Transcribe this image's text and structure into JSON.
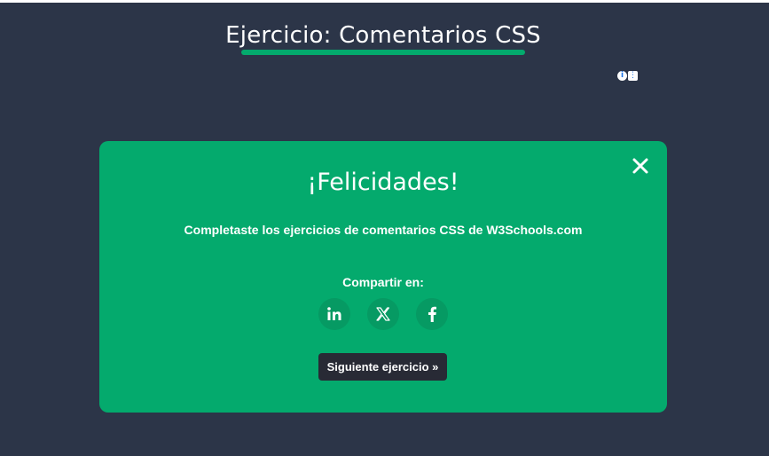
{
  "page": {
    "title": "Ejercicio: Comentarios CSS"
  },
  "ad_badge": {
    "info_icon": "info-icon",
    "menu_icon": "more-vertical-icon"
  },
  "modal": {
    "title": "¡Felicidades!",
    "message": "Completaste los ejercicios de comentarios CSS de W3Schools.com",
    "share_label": "Compartir en:",
    "share_buttons": [
      {
        "name": "linkedin",
        "icon": "linkedin-icon"
      },
      {
        "name": "x",
        "icon": "x-icon"
      },
      {
        "name": "facebook",
        "icon": "facebook-icon"
      }
    ],
    "next_label": "Siguiente ejercicio »",
    "close_icon": "close-icon"
  },
  "colors": {
    "background": "#2c3548",
    "accent": "#04aa6d",
    "share_button_bg": "#069a63",
    "next_button_bg": "#282a35",
    "text": "#ffffff"
  }
}
